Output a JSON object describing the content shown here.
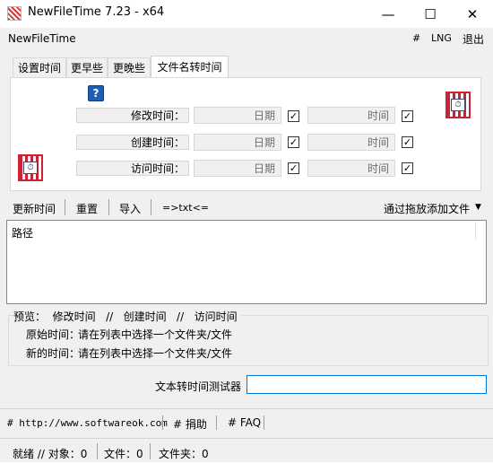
{
  "window": {
    "title": "NewFileTime 7.23 - x64",
    "minimize": "—",
    "maximize": "☐",
    "close": "✕"
  },
  "menu": {
    "app_name": "NewFileTime",
    "hash": "#",
    "lng": "LNG",
    "exit": "退出"
  },
  "tabs": [
    {
      "label": "设置时间"
    },
    {
      "label": "更早些"
    },
    {
      "label": "更晚些"
    },
    {
      "label": "文件名转时间"
    }
  ],
  "time_rows": [
    {
      "label": "修改时间：",
      "date_placeholder": "日期",
      "time_placeholder": "时间",
      "date_checked": true,
      "time_checked": true
    },
    {
      "label": "创建时间：",
      "date_placeholder": "日期",
      "time_placeholder": "时间",
      "date_checked": true,
      "time_checked": true
    },
    {
      "label": "访问时间：",
      "date_placeholder": "日期",
      "time_placeholder": "时间",
      "date_checked": true,
      "time_checked": true
    }
  ],
  "toolbar": {
    "update_time": "更新时间",
    "reset": "重置",
    "import": "导入",
    "txt": "=>txt<=",
    "drag_add": "通过拖放添加文件"
  },
  "list": {
    "column_path": "路径"
  },
  "preview": {
    "heading": "预览：  修改时间   //   创建时间   //   访问时间",
    "original_label": "原始时间：",
    "original_value": "请在列表中选择一个文件夹/文件",
    "new_label": "新的时间：",
    "new_value": "请在列表中选择一个文件夹/文件"
  },
  "tester": {
    "label": "文本转时间测试器",
    "value": ""
  },
  "links": {
    "website": "# http://www.softwareok.com",
    "donate": "# 捐助",
    "faq": "# FAQ"
  },
  "status": {
    "ready": "就绪 // 对象：0",
    "files": "文件：0",
    "folders": "文件夹：0"
  }
}
